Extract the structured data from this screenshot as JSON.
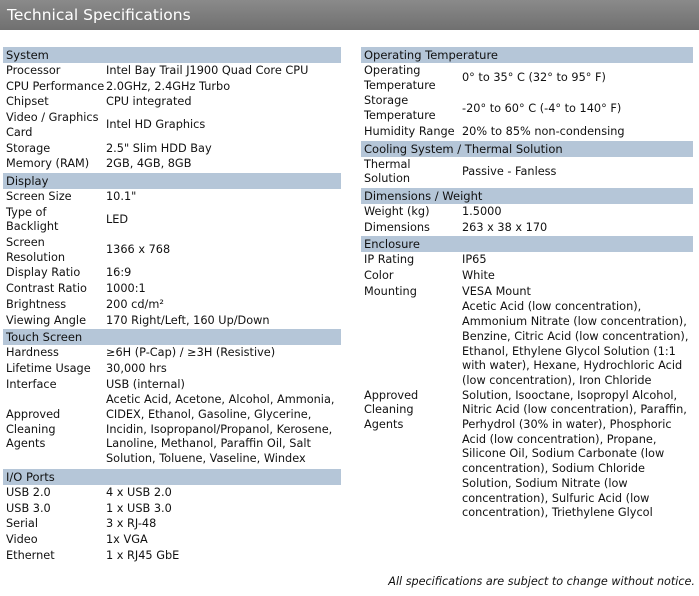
{
  "title": "Technical Specifications",
  "left": {
    "system": {
      "heading": "System",
      "rows": [
        {
          "k": "Processor",
          "v": "Intel Bay Trail J1900 Quad Core CPU"
        },
        {
          "k": "CPU Performance",
          "v": "2.0GHz, 2.4GHz Turbo"
        },
        {
          "k": "Chipset",
          "v": "CPU integrated"
        },
        {
          "k": "Video / Graphics Card",
          "v": "Intel HD Graphics"
        },
        {
          "k": "Storage",
          "v": "2.5\" Slim HDD Bay"
        },
        {
          "k": "Memory (RAM)",
          "v": "2GB, 4GB, 8GB"
        }
      ]
    },
    "display": {
      "heading": "Display",
      "rows": [
        {
          "k": "Screen Size",
          "v": "10.1\""
        },
        {
          "k": "Type of Backlight",
          "v": "LED"
        },
        {
          "k": "Screen Resolution",
          "v": "1366 x 768"
        },
        {
          "k": "Display Ratio",
          "v": "16:9"
        },
        {
          "k": "Contrast Ratio",
          "v": "1000:1"
        },
        {
          "k": "Brightness",
          "v": "200 cd/m²"
        },
        {
          "k": "Viewing Angle",
          "v": "170 Right/Left, 160 Up/Down"
        }
      ]
    },
    "touch": {
      "heading": "Touch Screen",
      "rows": [
        {
          "k": "Hardness",
          "v": "≥6H (P-Cap) / ≥3H (Resistive)"
        },
        {
          "k": "Lifetime Usage",
          "v": "30,000 hrs"
        },
        {
          "k": "Interface",
          "v": "USB (internal)"
        },
        {
          "k": "Approved Cleaning Agents",
          "v": "Acetic Acid, Acetone, Alcohol, Ammonia, CIDEX, Ethanol, Gasoline, Glycerine, Incidin, Isopropanol/Propanol, Kerosene, Lanoline, Methanol, Paraffin Oil, Salt Solution, Toluene, Vaseline, Windex"
        }
      ]
    },
    "io": {
      "heading": "I/O Ports",
      "rows": [
        {
          "k": "USB 2.0",
          "v": "4 x USB 2.0"
        },
        {
          "k": "USB 3.0",
          "v": "1 x USB 3.0"
        },
        {
          "k": "Serial",
          "v": "3 x RJ-48"
        },
        {
          "k": "Video",
          "v": "1x VGA"
        },
        {
          "k": "Ethernet",
          "v": "1 x RJ45 GbE"
        }
      ]
    }
  },
  "right": {
    "optemp": {
      "heading": "Operating Temperature",
      "rows": [
        {
          "k": "Operating Temperature",
          "v": "0° to 35° C (32° to 95° F)"
        },
        {
          "k": "Storage Temperature",
          "v": "-20° to 60° C (-4° to 140° F)"
        },
        {
          "k": "Humidity Range",
          "v": "20% to 85% non-condensing"
        }
      ]
    },
    "cooling": {
      "heading": "Cooling System / Thermal Solution",
      "rows": [
        {
          "k": "Thermal Solution",
          "v": "Passive - Fanless"
        }
      ]
    },
    "dims": {
      "heading": "Dimensions / Weight",
      "rows": [
        {
          "k": "Weight (kg)",
          "v": "1.5000"
        },
        {
          "k": "Dimensions",
          "v": "263 x 38 x 170"
        }
      ]
    },
    "enclosure": {
      "heading": "Enclosure",
      "rows": [
        {
          "k": "IP Rating",
          "v": "IP65"
        },
        {
          "k": "Color",
          "v": "White"
        },
        {
          "k": "Mounting",
          "v": "VESA Mount"
        },
        {
          "k": "Approved Cleaning Agents",
          "v": "Acetic Acid (low concentration), Ammonium Nitrate (low concentration), Benzine, Citric Acid (low concentration), Ethanol, Ethylene Glycol Solution (1:1 with water), Hexane, Hydrochloric Acid (low concentration), Iron Chloride Solution, Isooctane, Isopropyl Alcohol, Nitric Acid (low concentration), Paraffin, Perhydrol (30% in water), Phosphoric Acid (low concentration), Propane, Silicone Oil, Sodium Carbonate (low concentration), Sodium Chloride Solution, Sodium Nitrate (low concentration), Sulfuric Acid (low concentration), Triethylene Glycol"
        }
      ]
    }
  },
  "footer": "All specifications are subject to change without notice.",
  "colors": {
    "title_bar": "#7a7a7a",
    "section_head": "#b5c6d8"
  }
}
